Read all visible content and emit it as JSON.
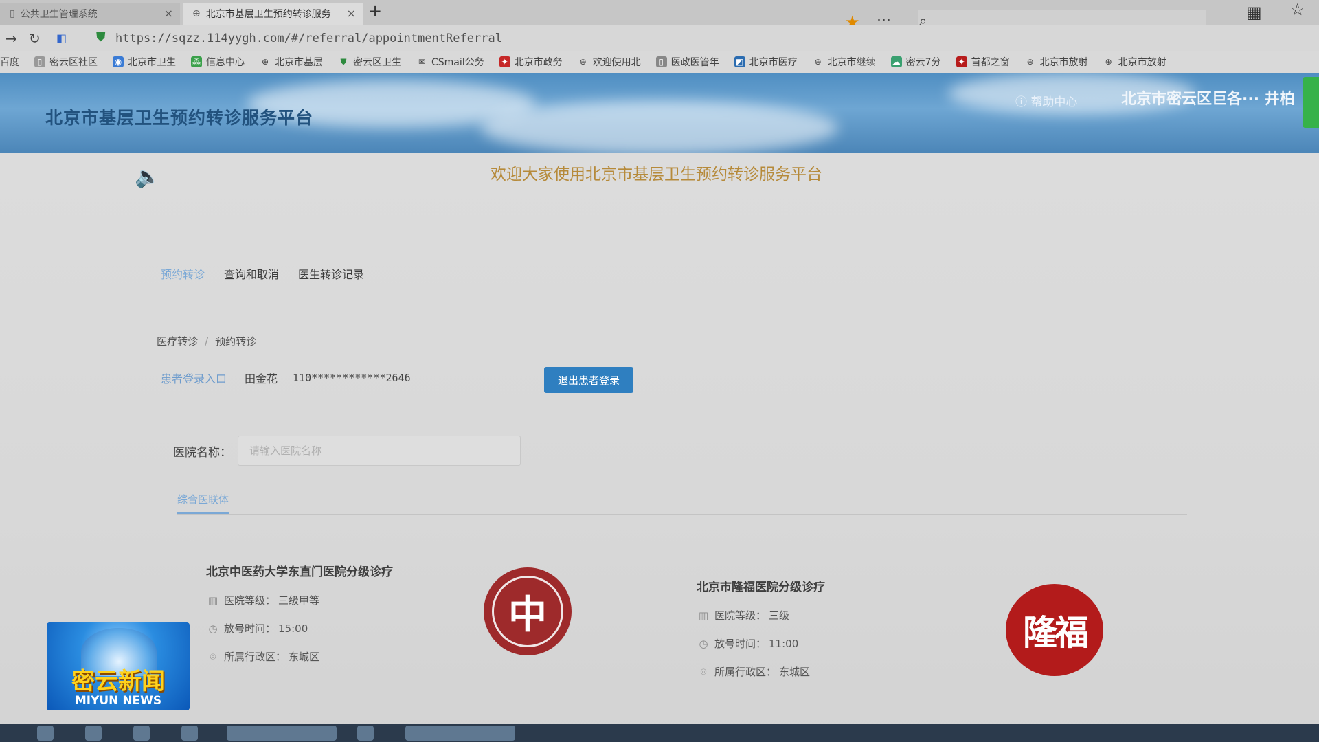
{
  "browser": {
    "tabs": [
      {
        "title": "公共卫生管理系统",
        "close": "×"
      },
      {
        "title": "北京市基层卫生预约转诊服务",
        "close": "×"
      }
    ],
    "new_tab": "+",
    "url": "https://sqzz.114yygh.com/#/referral/appointmentReferral",
    "bookmarks": [
      "百度",
      "密云区社区",
      "北京市卫生",
      "信息中心",
      "北京市基层",
      "密云区卫生",
      "CSmail公务",
      "北京市政务",
      "欢迎使用北",
      "医政医管年",
      "北京市医疗",
      "北京市继续",
      "密云7分",
      "首都之窗",
      "北京市放射",
      "北京市放射"
    ]
  },
  "header": {
    "title": "北京市基层卫生预约转诊服务平台",
    "help": "帮助中心",
    "org": "北京市密云区巨各··· 井柏"
  },
  "welcome": "欢迎大家使用北京市基层卫生预约转诊服务平台",
  "main_tabs": [
    "预约转诊",
    "查询和取消",
    "医生转诊记录"
  ],
  "breadcrumb": {
    "root": "医疗转诊",
    "sep": "/",
    "current": "预约转诊"
  },
  "patient": {
    "login_label": "患者登录入口",
    "name": "田金花",
    "id_masked": "110************2646",
    "logout_button": "退出患者登录"
  },
  "search": {
    "label": "医院名称：",
    "placeholder": "请输入医院名称",
    "value": ""
  },
  "category_tab": "综合医联体",
  "hospitals": [
    {
      "name": "北京中医药大学东直门医院分级诊疗",
      "level_label": "医院等级：",
      "level": "三级甲等",
      "time_label": "放号时间：",
      "time": "15:00",
      "district_label": "所属行政区：",
      "district": "东城区",
      "logo_text": "中"
    },
    {
      "name": "北京市隆福医院分级诊疗",
      "level_label": "医院等级：",
      "level": "三级",
      "time_label": "放号时间：",
      "time": "11:00",
      "district_label": "所属行政区：",
      "district": "东城区",
      "logo_text": "隆福"
    }
  ],
  "news_badge": {
    "cn": "密云新闻",
    "en": "MIYUN NEWS"
  },
  "colors": {
    "accent": "#2f7fc0",
    "active_tab": "#7aa8d6",
    "welcome": "#b68a3a",
    "header_bg": "#5a98cc"
  }
}
